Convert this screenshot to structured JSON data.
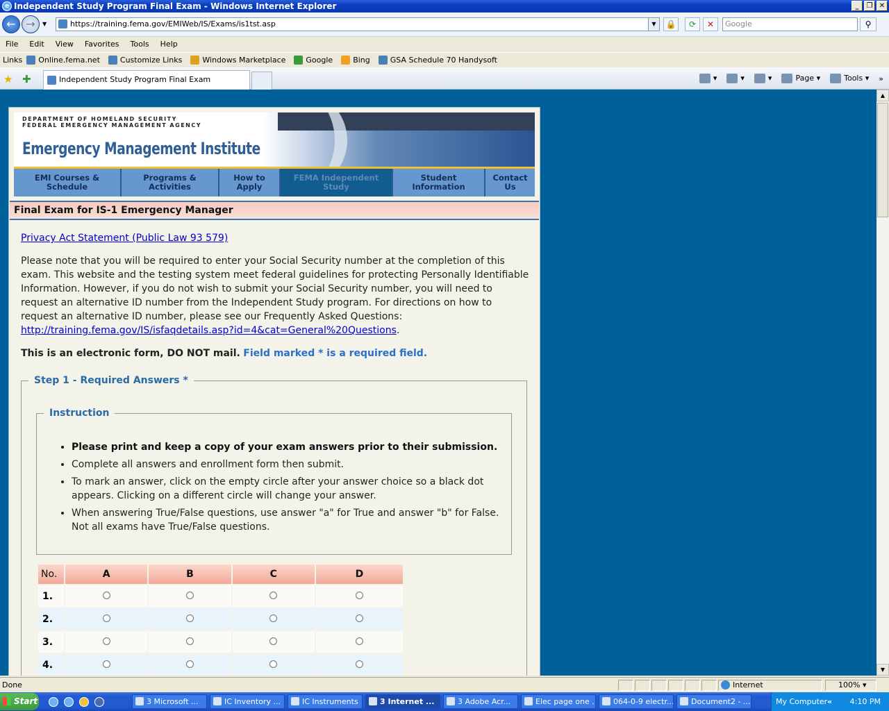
{
  "window": {
    "title": "Independent Study Program Final Exam - Windows Internet Explorer"
  },
  "address": {
    "url": "https://training.fema.gov/EMIWeb/IS/Exams/is1tst.asp",
    "search_placeholder": "Google"
  },
  "menu": [
    "File",
    "Edit",
    "View",
    "Favorites",
    "Tools",
    "Help"
  ],
  "links_bar": {
    "label": "Links",
    "items": [
      "Online.fema.net",
      "Customize Links",
      "Windows Marketplace",
      "Google",
      "Bing",
      "GSA Schedule 70  Handysoft"
    ]
  },
  "tab": {
    "title": "Independent Study Program Final Exam"
  },
  "command_bar": {
    "page_label": "Page",
    "tools_label": "Tools"
  },
  "banner": {
    "agency_line1": "DEPARTMENT OF HOMELAND SECURITY",
    "agency_line2": "FEDERAL EMERGENCY MANAGEMENT AGENCY",
    "title": "Emergency Management Institute"
  },
  "nav": [
    {
      "line1": "EMI Courses &",
      "line2": "Schedule"
    },
    {
      "line1": "Programs &",
      "line2": "Activities"
    },
    {
      "line1": "How to",
      "line2": "Apply"
    },
    {
      "line1": "FEMA Independent",
      "line2": "Study"
    },
    {
      "line1": "Student",
      "line2": "Information"
    },
    {
      "line1": "Contact",
      "line2": "Us"
    }
  ],
  "exam": {
    "header": "Final Exam for IS-1 Emergency Manager",
    "privacy_link": "Privacy Act Statement (Public Law 93 579)",
    "notice": "Please note that you will be required to enter your Social Security number at the completion of this exam. This website and the testing system meet federal guidelines for protecting Personally Identifiable Information. However, if you do not wish to submit your Social Security number, you will need to request an alternative ID number from the Independent Study program. For directions on how to request an alternative ID number, please see our Frequently Asked Questions:",
    "faq_link": "http://training.fema.gov/IS/isfaqdetails.asp?id=4&cat=General%20Questions",
    "faq_suffix": ".",
    "electronic_notice": "This is an electronic form, DO NOT mail.",
    "required_notice": "Field marked * is a required field.",
    "step1_legend": "Step 1 - Required Answers *",
    "instruction_legend": "Instruction",
    "instructions": [
      "Please print and keep a copy of your exam answers prior to their submission.",
      "Complete all answers and enrollment form then submit.",
      "To mark an answer, click on the empty circle after your answer choice so a black dot appears. Clicking on a different circle will change your answer.",
      "When answering True/False questions, use answer \"a\" for True and answer \"b\" for False. Not all exams have True/False questions."
    ],
    "table_headers": [
      "No.",
      "A",
      "B",
      "C",
      "D"
    ],
    "rows": [
      "1.",
      "2.",
      "3.",
      "4."
    ]
  },
  "status": {
    "text": "Done",
    "zone": "Internet",
    "zoom": "100%"
  },
  "taskbar": {
    "start": "Start",
    "tasks": [
      "3 Microsoft ...",
      "IC Inventory ...",
      "IC Instruments",
      "3 Internet ...",
      "3 Adobe Acr...",
      "Elec page one ...",
      "064-0-9 electr...",
      "Document2 - ..."
    ],
    "tray_label": "My Computer",
    "clock": "4:10 PM"
  }
}
